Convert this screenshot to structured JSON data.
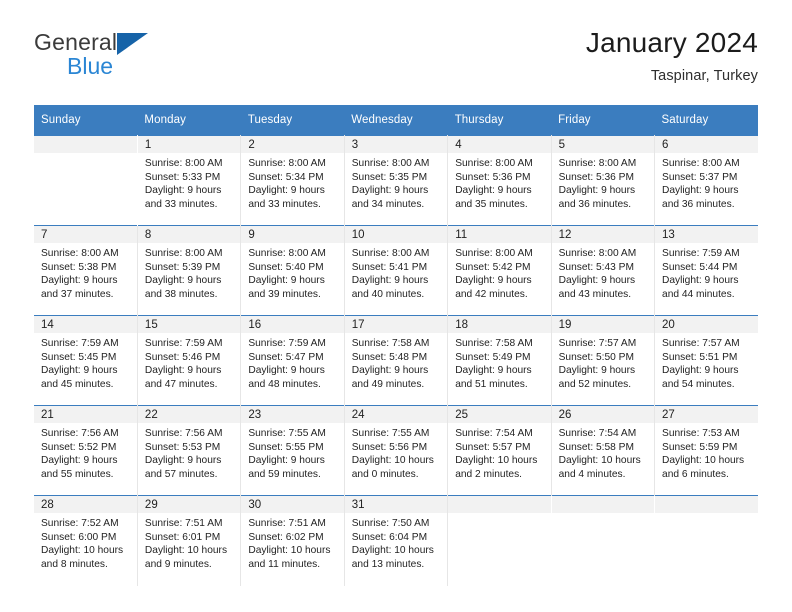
{
  "brand": {
    "name_top": "General",
    "name_bottom": "Blue",
    "triangle_color": "#1663a8",
    "blue_text_color": "#2b86d4"
  },
  "header": {
    "title": "January 2024",
    "subtitle": "Taspinar, Turkey"
  },
  "theme": {
    "header_row_bg": "#3b7dbf",
    "header_row_text": "#ffffff",
    "daynum_band_bg": "#f2f2f2",
    "cell_border": "#e6e6e6"
  },
  "weekdays": [
    "Sunday",
    "Monday",
    "Tuesday",
    "Wednesday",
    "Thursday",
    "Friday",
    "Saturday"
  ],
  "weeks": [
    [
      {
        "day": "",
        "lines": []
      },
      {
        "day": "1",
        "lines": [
          "Sunrise: 8:00 AM",
          "Sunset: 5:33 PM",
          "Daylight: 9 hours",
          "and 33 minutes."
        ]
      },
      {
        "day": "2",
        "lines": [
          "Sunrise: 8:00 AM",
          "Sunset: 5:34 PM",
          "Daylight: 9 hours",
          "and 33 minutes."
        ]
      },
      {
        "day": "3",
        "lines": [
          "Sunrise: 8:00 AM",
          "Sunset: 5:35 PM",
          "Daylight: 9 hours",
          "and 34 minutes."
        ]
      },
      {
        "day": "4",
        "lines": [
          "Sunrise: 8:00 AM",
          "Sunset: 5:36 PM",
          "Daylight: 9 hours",
          "and 35 minutes."
        ]
      },
      {
        "day": "5",
        "lines": [
          "Sunrise: 8:00 AM",
          "Sunset: 5:36 PM",
          "Daylight: 9 hours",
          "and 36 minutes."
        ]
      },
      {
        "day": "6",
        "lines": [
          "Sunrise: 8:00 AM",
          "Sunset: 5:37 PM",
          "Daylight: 9 hours",
          "and 36 minutes."
        ]
      }
    ],
    [
      {
        "day": "7",
        "lines": [
          "Sunrise: 8:00 AM",
          "Sunset: 5:38 PM",
          "Daylight: 9 hours",
          "and 37 minutes."
        ]
      },
      {
        "day": "8",
        "lines": [
          "Sunrise: 8:00 AM",
          "Sunset: 5:39 PM",
          "Daylight: 9 hours",
          "and 38 minutes."
        ]
      },
      {
        "day": "9",
        "lines": [
          "Sunrise: 8:00 AM",
          "Sunset: 5:40 PM",
          "Daylight: 9 hours",
          "and 39 minutes."
        ]
      },
      {
        "day": "10",
        "lines": [
          "Sunrise: 8:00 AM",
          "Sunset: 5:41 PM",
          "Daylight: 9 hours",
          "and 40 minutes."
        ]
      },
      {
        "day": "11",
        "lines": [
          "Sunrise: 8:00 AM",
          "Sunset: 5:42 PM",
          "Daylight: 9 hours",
          "and 42 minutes."
        ]
      },
      {
        "day": "12",
        "lines": [
          "Sunrise: 8:00 AM",
          "Sunset: 5:43 PM",
          "Daylight: 9 hours",
          "and 43 minutes."
        ]
      },
      {
        "day": "13",
        "lines": [
          "Sunrise: 7:59 AM",
          "Sunset: 5:44 PM",
          "Daylight: 9 hours",
          "and 44 minutes."
        ]
      }
    ],
    [
      {
        "day": "14",
        "lines": [
          "Sunrise: 7:59 AM",
          "Sunset: 5:45 PM",
          "Daylight: 9 hours",
          "and 45 minutes."
        ]
      },
      {
        "day": "15",
        "lines": [
          "Sunrise: 7:59 AM",
          "Sunset: 5:46 PM",
          "Daylight: 9 hours",
          "and 47 minutes."
        ]
      },
      {
        "day": "16",
        "lines": [
          "Sunrise: 7:59 AM",
          "Sunset: 5:47 PM",
          "Daylight: 9 hours",
          "and 48 minutes."
        ]
      },
      {
        "day": "17",
        "lines": [
          "Sunrise: 7:58 AM",
          "Sunset: 5:48 PM",
          "Daylight: 9 hours",
          "and 49 minutes."
        ]
      },
      {
        "day": "18",
        "lines": [
          "Sunrise: 7:58 AM",
          "Sunset: 5:49 PM",
          "Daylight: 9 hours",
          "and 51 minutes."
        ]
      },
      {
        "day": "19",
        "lines": [
          "Sunrise: 7:57 AM",
          "Sunset: 5:50 PM",
          "Daylight: 9 hours",
          "and 52 minutes."
        ]
      },
      {
        "day": "20",
        "lines": [
          "Sunrise: 7:57 AM",
          "Sunset: 5:51 PM",
          "Daylight: 9 hours",
          "and 54 minutes."
        ]
      }
    ],
    [
      {
        "day": "21",
        "lines": [
          "Sunrise: 7:56 AM",
          "Sunset: 5:52 PM",
          "Daylight: 9 hours",
          "and 55 minutes."
        ]
      },
      {
        "day": "22",
        "lines": [
          "Sunrise: 7:56 AM",
          "Sunset: 5:53 PM",
          "Daylight: 9 hours",
          "and 57 minutes."
        ]
      },
      {
        "day": "23",
        "lines": [
          "Sunrise: 7:55 AM",
          "Sunset: 5:55 PM",
          "Daylight: 9 hours",
          "and 59 minutes."
        ]
      },
      {
        "day": "24",
        "lines": [
          "Sunrise: 7:55 AM",
          "Sunset: 5:56 PM",
          "Daylight: 10 hours",
          "and 0 minutes."
        ]
      },
      {
        "day": "25",
        "lines": [
          "Sunrise: 7:54 AM",
          "Sunset: 5:57 PM",
          "Daylight: 10 hours",
          "and 2 minutes."
        ]
      },
      {
        "day": "26",
        "lines": [
          "Sunrise: 7:54 AM",
          "Sunset: 5:58 PM",
          "Daylight: 10 hours",
          "and 4 minutes."
        ]
      },
      {
        "day": "27",
        "lines": [
          "Sunrise: 7:53 AM",
          "Sunset: 5:59 PM",
          "Daylight: 10 hours",
          "and 6 minutes."
        ]
      }
    ],
    [
      {
        "day": "28",
        "lines": [
          "Sunrise: 7:52 AM",
          "Sunset: 6:00 PM",
          "Daylight: 10 hours",
          "and 8 minutes."
        ]
      },
      {
        "day": "29",
        "lines": [
          "Sunrise: 7:51 AM",
          "Sunset: 6:01 PM",
          "Daylight: 10 hours",
          "and 9 minutes."
        ]
      },
      {
        "day": "30",
        "lines": [
          "Sunrise: 7:51 AM",
          "Sunset: 6:02 PM",
          "Daylight: 10 hours",
          "and 11 minutes."
        ]
      },
      {
        "day": "31",
        "lines": [
          "Sunrise: 7:50 AM",
          "Sunset: 6:04 PM",
          "Daylight: 10 hours",
          "and 13 minutes."
        ]
      },
      {
        "day": "",
        "lines": []
      },
      {
        "day": "",
        "lines": []
      },
      {
        "day": "",
        "lines": []
      }
    ]
  ]
}
